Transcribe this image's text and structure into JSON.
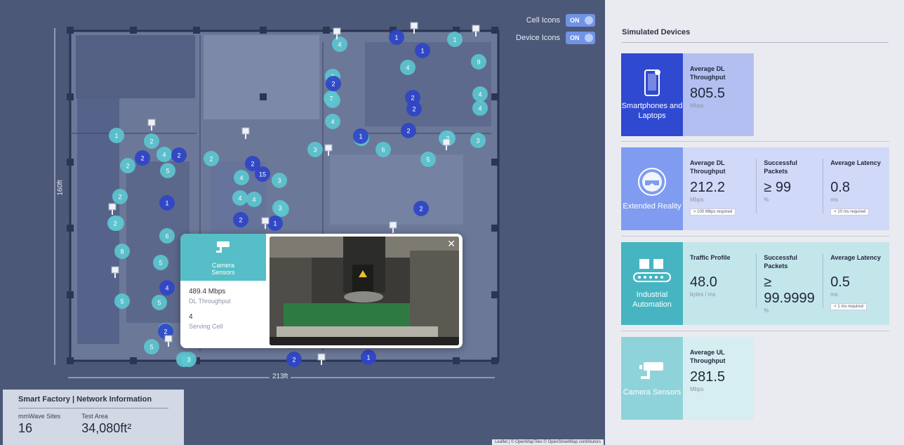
{
  "map": {
    "toggles": [
      {
        "label": "Cell Icons",
        "state": "ON"
      },
      {
        "label": "Device Icons",
        "state": "ON"
      }
    ],
    "dims": {
      "height": "160ft",
      "width": "213ft"
    },
    "popup": {
      "title": "Camera Sensors",
      "throughput": "489.4 Mbps",
      "throughput_label": "DL Throughput",
      "cell": "4",
      "cell_label": "Serving Cell",
      "close": "✕"
    },
    "info": {
      "title": "Smart Factory | Network Information",
      "sites_label": "mmWave Sites",
      "sites": "16",
      "area_label": "Test Area",
      "area": "34,080ft²"
    },
    "attribution": "Leaflet | © OpenMapTiles © OpenStreetMap contributors",
    "colors": {
      "dark": "#2f45c8",
      "light": "#5cc6cf",
      "mid": "#7a95ea"
    },
    "device_labels": {
      "dark": [
        "1",
        "2",
        "2",
        "1",
        "2",
        "15",
        "1",
        "2",
        "2",
        "2",
        "2",
        "1",
        "4",
        "2",
        "2",
        "2",
        "1",
        "2",
        "1"
      ],
      "light": [
        "4",
        "5",
        "1",
        "2",
        "2",
        "4",
        "5",
        "3",
        "7",
        "2",
        "4",
        "6",
        "3",
        "2",
        "1",
        "3",
        "3",
        "2",
        "5",
        "3",
        "4",
        "5",
        "6",
        "5",
        "5",
        "3",
        "2",
        "1",
        "4",
        "2",
        "6",
        "8",
        "9",
        "4",
        "4",
        "3",
        "7",
        "2",
        "3",
        "4",
        "4"
      ]
    }
  },
  "panel": {
    "title": "Simulated Devices",
    "cards": [
      {
        "name": "Smartphones and Laptops",
        "icon": "smartphone-icon",
        "color": "#2f49d1",
        "bg": "#b3bff0",
        "metrics": [
          {
            "label": "Average DL Throughput",
            "value": "805.5",
            "unit": "Mbps"
          }
        ]
      },
      {
        "name": "Extended Reality",
        "icon": "vr-headset-icon",
        "color": "#7f9cf0",
        "bg": "#d1d9f8",
        "metrics": [
          {
            "label": "Average DL Throughput",
            "value": "212.2",
            "unit": "Mbps",
            "req": "> 100 Mbps required"
          },
          {
            "label": "Successful Packets",
            "value": "≥ 99",
            "unit": "%"
          },
          {
            "label": "Average Latency",
            "value": "0.8",
            "unit": "ms",
            "req": "< 10 ms required"
          }
        ]
      },
      {
        "name": "Industrial Automation",
        "icon": "conveyor-icon",
        "color": "#46b5c1",
        "bg": "#c3e6ea",
        "metrics": [
          {
            "label": "Traffic Profile",
            "value": "48.0",
            "unit": "bytes / ms"
          },
          {
            "label": "Successful Packets",
            "value": "≥ 99.9999",
            "unit": "%"
          },
          {
            "label": "Average Latency",
            "value": "0.5",
            "unit": "ms",
            "req": "< 1 ms required"
          }
        ]
      },
      {
        "name": "Camera Sensors",
        "icon": "camera-icon",
        "color": "#8fd3da",
        "bg": "#d6eef1",
        "metrics": [
          {
            "label": "Average UL Throughput",
            "value": "281.5",
            "unit": "Mbps"
          }
        ]
      }
    ]
  }
}
